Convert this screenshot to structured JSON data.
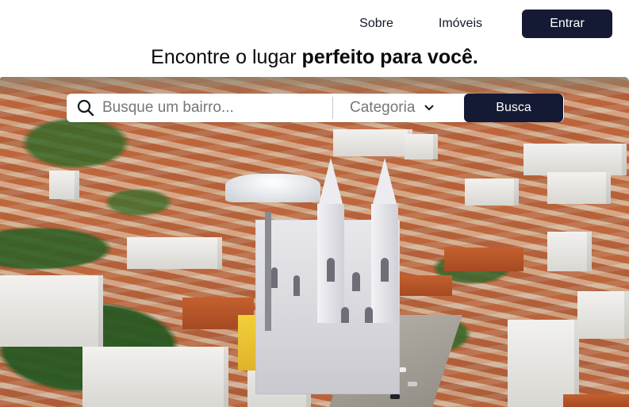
{
  "nav": {
    "about_label": "Sobre",
    "properties_label": "Imóveis",
    "login_label": "Entrar"
  },
  "hero": {
    "headline_prefix": "Encontre o lugar ",
    "headline_strong": "perfeito para você."
  },
  "search": {
    "placeholder": "Busque um bairro...",
    "value": "",
    "category_label": "Categoria",
    "submit_label": "Busca"
  },
  "colors": {
    "primary_dark": "#141a33",
    "background": "#ffffff",
    "placeholder_text": "#777777"
  },
  "icons": {
    "search": "search-icon",
    "category_dropdown": "chevron-down-icon"
  }
}
